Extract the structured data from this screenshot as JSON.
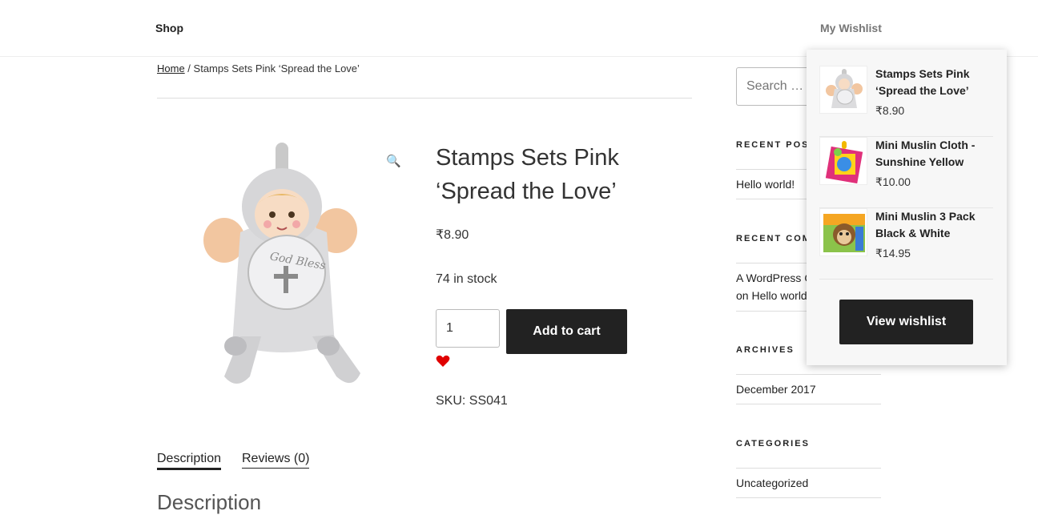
{
  "nav": {
    "shop": "Shop",
    "wishlist": "My Wishlist"
  },
  "breadcrumb": {
    "home": "Home",
    "separator": " / ",
    "current": "Stamps Sets Pink ‘Spread the Love’"
  },
  "product": {
    "title": "Stamps Sets Pink ‘Spread the Love’",
    "price": "₹8.90",
    "stock": "74 in stock",
    "quantity": "1",
    "add_to_cart": "Add to cart",
    "sku": "SKU: SS041",
    "image_text": "God Bless"
  },
  "tabs": {
    "description": "Description",
    "reviews": "Reviews (0)"
  },
  "description_heading": "Description",
  "sidebar": {
    "search_placeholder": "Search …",
    "recent_posts_title": "RECENT POSTS",
    "recent_posts": [
      "Hello world!"
    ],
    "recent_comments_title": "RECENT COMMENTS",
    "recent_comment_line1": "A WordPress Commenter",
    "recent_comment_line2": "on Hello world!",
    "archives_title": "ARCHIVES",
    "archives": [
      "December 2017"
    ],
    "categories_title": "CATEGORIES",
    "categories": [
      "Uncategorized"
    ]
  },
  "wishlist": {
    "items": [
      {
        "name_line1": "Stamps Sets Pink",
        "name_line2": "‘Spread the Love’",
        "price": "₹8.90"
      },
      {
        "name_line1": "Mini Muslin Cloth -",
        "name_line2": "Sunshine Yellow",
        "price": "₹10.00"
      },
      {
        "name_line1": "Mini Muslin 3 Pack",
        "name_line2": "Black & White",
        "price": "₹14.95"
      }
    ],
    "view_button": "View wishlist"
  },
  "colors": {
    "button_bg": "#222222",
    "heart": "#e00000",
    "wishlist_bg": "#f7f7f7"
  }
}
